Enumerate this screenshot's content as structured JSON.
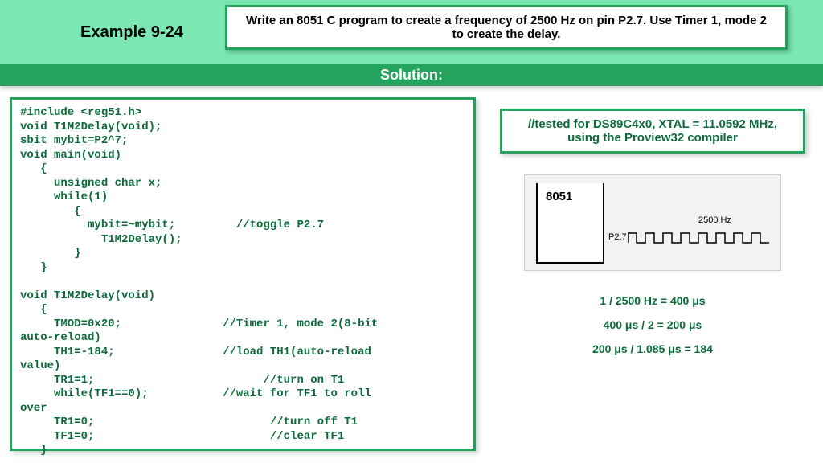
{
  "header": {
    "example_label": "Example 9-24",
    "problem": "Write an 8051 C program to create a frequency of 2500 Hz on pin P2.7.  Use Timer 1, mode 2 to create the delay.",
    "solution_label": "Solution:"
  },
  "code": "#include <reg51.h>\nvoid T1M2Delay(void);\nsbit mybit=P2^7;\nvoid main(void)\n   {\n     unsigned char x;\n     while(1)\n        {\n          mybit=~mybit;         //toggle P2.7\n            T1M2Delay();\n        }\n   }\n\nvoid T1M2Delay(void)\n   {\n     TMOD=0x20;               //Timer 1, mode 2(8-bit\nauto-reload)\n     TH1=-184;                //load TH1(auto-reload\nvalue)\n     TR1=1;                         //turn on T1\n     while(TF1==0);           //wait for TF1 to roll\nover\n     TR1=0;                          //turn off T1\n     TF1=0;                          //clear TF1\n   }",
  "note": "//tested for DS89C4x0, XTAL = 11.0592 MHz, using the Proview32 compiler",
  "diagram": {
    "chip": "8051",
    "pin": "P2.7",
    "freq": "2500 Hz"
  },
  "calcs": {
    "line1": "1 / 2500 Hz = 400 μs",
    "line2": "400 μs / 2 = 200 μs",
    "line3": "200 μs / 1.085 μs = 184"
  }
}
